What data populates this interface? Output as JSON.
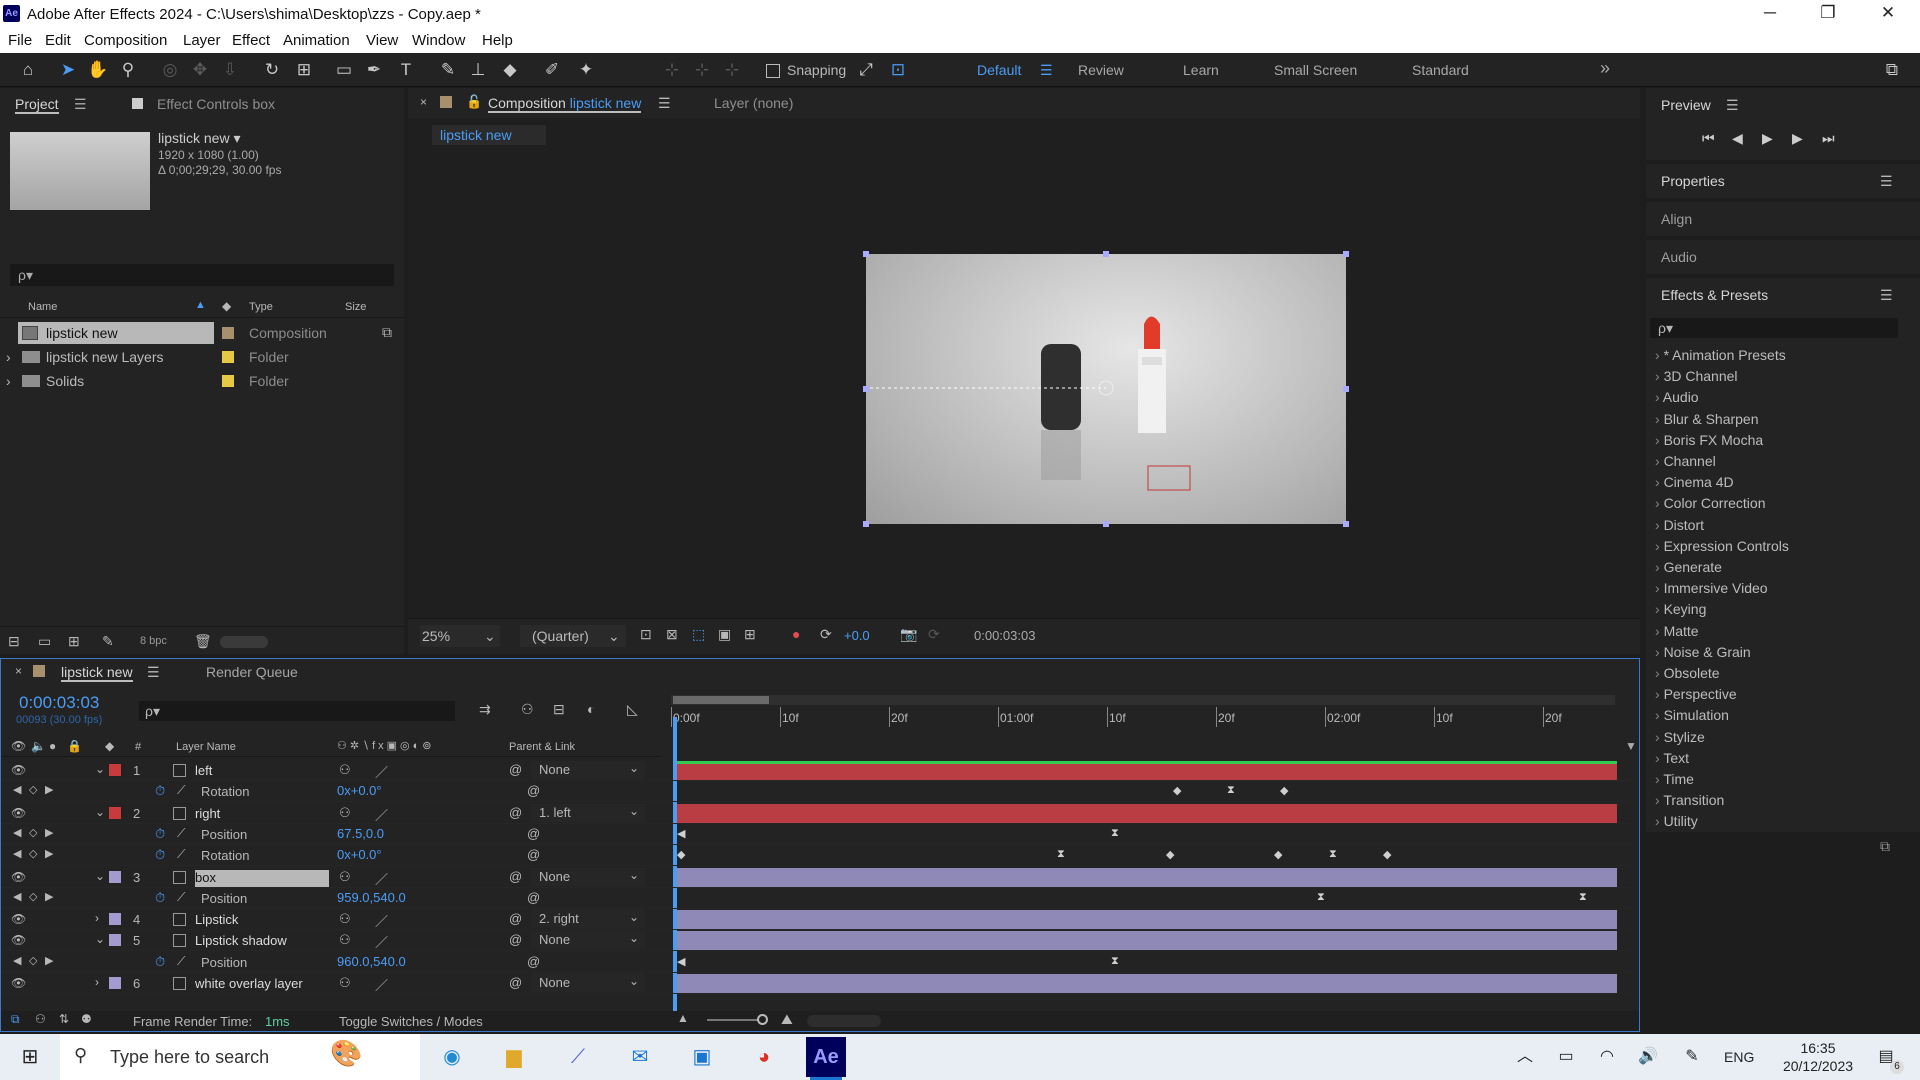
{
  "window": {
    "title": "Adobe After Effects 2024 - C:\\Users\\shima\\Desktop\\zzs - Copy.aep *",
    "logo": "Ae"
  },
  "menu": [
    "File",
    "Edit",
    "Composition",
    "Layer",
    "Effect",
    "Animation",
    "View",
    "Window",
    "Help"
  ],
  "toolbar": {
    "snapping": "Snapping",
    "workspaces": [
      "Default",
      "Review",
      "Learn",
      "Small Screen",
      "Standard"
    ],
    "more": "»"
  },
  "project": {
    "tab_project": "Project",
    "tab_effect_controls": "Effect Controls box",
    "comp_name": "lipstick new ▾",
    "comp_size": "1920 x 1080 (1.00)",
    "comp_duration": "Δ 0;00;29;29, 30.00 fps",
    "search_placeholder": "ρ▾",
    "col_name": "Name",
    "col_type": "Type",
    "col_size": "Size",
    "items": [
      {
        "name": "lipstick new",
        "type": "Composition",
        "color": "#a88f6e"
      },
      {
        "name": "lipstick new Layers",
        "type": "Folder",
        "color": "#e5c946"
      },
      {
        "name": "Solids",
        "type": "Folder",
        "color": "#e5c946"
      }
    ],
    "bpc": "8 bpc"
  },
  "comp": {
    "tab_label": "Composition",
    "tab_name": "lipstick new",
    "layer_tab": "Layer  (none)",
    "breadcrumb": "lipstick new",
    "zoom": "25%",
    "resolution": "(Quarter)",
    "exposure": "+0.0",
    "timecode": "0:00:03:03"
  },
  "preview": {
    "title": "Preview"
  },
  "side_panels": {
    "properties": "Properties",
    "align": "Align",
    "audio": "Audio",
    "effects": "Effects & Presets",
    "search": "ρ▾"
  },
  "effects_list": [
    "* Animation Presets",
    "3D Channel",
    "Audio",
    "Blur & Sharpen",
    "Boris FX Mocha",
    "Channel",
    "Cinema 4D",
    "Color Correction",
    "Distort",
    "Expression Controls",
    "Generate",
    "Immersive Video",
    "Keying",
    "Matte",
    "Noise & Grain",
    "Obsolete",
    "Perspective",
    "Simulation",
    "Stylize",
    "Text",
    "Time",
    "Transition",
    "Utility"
  ],
  "timeline": {
    "tab": "lipstick new",
    "render_queue": "Render Queue",
    "timecode": "0:00:03:03",
    "fps": "00093 (30.00 fps)",
    "col_num": "#",
    "col_layer": "Layer Name",
    "col_parent": "Parent & Link",
    "ruler": [
      "0:00f",
      "10f",
      "20f",
      "01:00f",
      "10f",
      "20f",
      "02:00f",
      "10f",
      "20f"
    ],
    "frame_render_label": "Frame Render Time:",
    "frame_render_value": "1ms",
    "toggle": "Toggle Switches / Modes",
    "rows": [
      {
        "kind": "layer",
        "num": "1",
        "name": "left",
        "label": "#c93a3a",
        "parent": "None",
        "twirl": "⌄"
      },
      {
        "kind": "prop",
        "name": "Rotation",
        "value": "0x+0.0°"
      },
      {
        "kind": "layer",
        "num": "2",
        "name": "right",
        "label": "#c93a3a",
        "parent": "1. left",
        "twirl": "⌄"
      },
      {
        "kind": "prop",
        "name": "Position",
        "value": "67.5,0.0"
      },
      {
        "kind": "prop",
        "name": "Rotation",
        "value": "0x+0.0°"
      },
      {
        "kind": "layer",
        "num": "3",
        "name": "box",
        "label": "#a39bd0",
        "parent": "None",
        "twirl": "⌄",
        "selected": true
      },
      {
        "kind": "prop",
        "name": "Position",
        "value": "959.0,540.0"
      },
      {
        "kind": "layer",
        "num": "4",
        "name": "Lipstick",
        "label": "#a39bd0",
        "parent": "2. right",
        "twirl": "›"
      },
      {
        "kind": "layer",
        "num": "5",
        "name": "Lipstick shadow",
        "label": "#a39bd0",
        "parent": "None",
        "twirl": "⌄"
      },
      {
        "kind": "prop",
        "name": "Position",
        "value": "960.0,540.0"
      },
      {
        "kind": "layer",
        "num": "6",
        "name": "white overlay layer",
        "label": "#a39bd0",
        "parent": "None",
        "twirl": "›"
      }
    ]
  },
  "taskbar": {
    "search": "Type here to search",
    "lang": "ENG",
    "time": "16:35",
    "date": "20/12/2023",
    "notif": "6"
  }
}
